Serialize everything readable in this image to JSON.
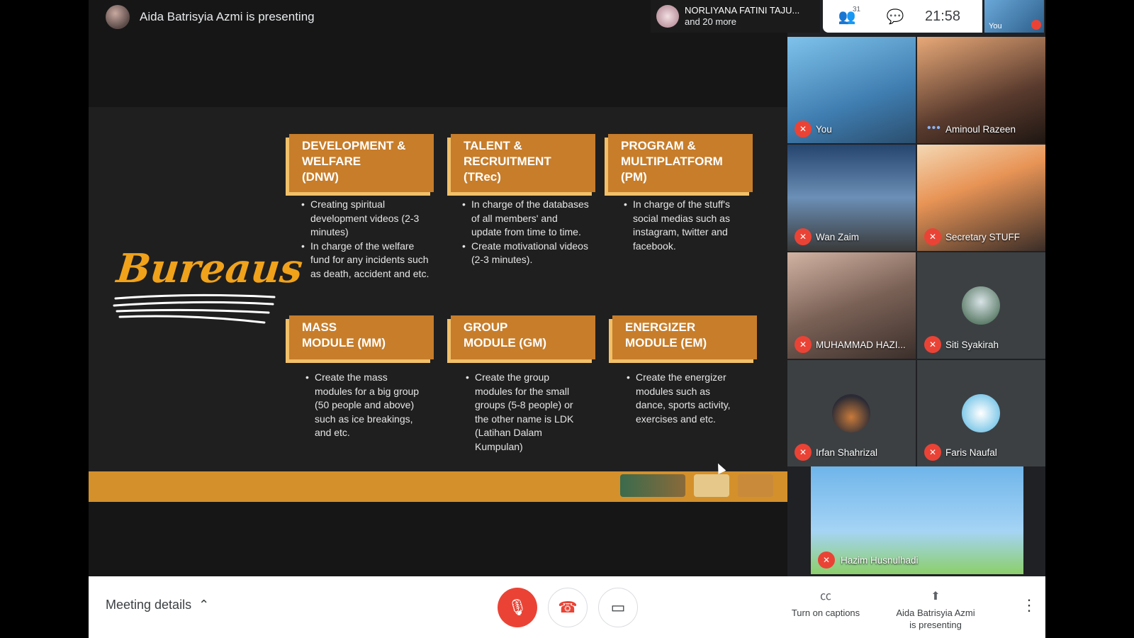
{
  "presenter": {
    "status": "Aida Batrisyia Azmi is presenting"
  },
  "active_speaker": {
    "name": "NORLIYANA FATINI TAJU...",
    "more": "and 20 more"
  },
  "top_controls": {
    "participant_count": "31",
    "time": "21:58",
    "self_label": "You"
  },
  "slide": {
    "heading": "Bureaus",
    "cards": [
      {
        "title": "DEVELOPMENT &\nWELFARE\n(DNW)",
        "bullets": [
          "Creating spiritual development videos (2-3 minutes)",
          "In charge of the welfare fund for any incidents such as death, accident and etc."
        ]
      },
      {
        "title": "TALENT &\nRECRUITMENT\n(TRec)",
        "bullets": [
          "In charge of the databases of all members' and update from time to time.",
          "Create  motivational videos (2-3 minutes)."
        ]
      },
      {
        "title": "PROGRAM &\nMULTIPLATFORM\n(PM)",
        "bullets": [
          "In charge of the stuff's social medias such as instagram, twitter and facebook."
        ]
      },
      {
        "title": "MASS\nMODULE (MM)",
        "bullets": [
          "Create the mass modules for a big group (50 people and above) such as ice breakings, and etc."
        ]
      },
      {
        "title": "GROUP\nMODULE (GM)",
        "bullets": [
          "Create the group modules for the small groups (5-8 people) or the other name is LDK (Latihan Dalam Kumpulan)"
        ]
      },
      {
        "title": "ENERGIZER\nMODULE (EM)",
        "bullets": [
          "Create the energizer modules such as dance, sports activity, exercises and etc."
        ]
      }
    ]
  },
  "participants": [
    {
      "name": "You",
      "muted": true
    },
    {
      "name": "Aminoul Razeen",
      "muted": false
    },
    {
      "name": "Wan Zaim",
      "muted": true
    },
    {
      "name": "Secretary STUFF",
      "muted": true
    },
    {
      "name": "MUHAMMAD HAZI...",
      "muted": true
    },
    {
      "name": "Siti Syakirah",
      "muted": true
    },
    {
      "name": "Irfan Shahrizal",
      "muted": true
    },
    {
      "name": "Faris Naufal",
      "muted": true
    }
  ],
  "self_view": {
    "name": "Hazim Husnulhadi"
  },
  "bottom_bar": {
    "meeting_details": "Meeting details",
    "captions": "Turn on captions",
    "presenting_line1": "Aida Batrisyia Azmi",
    "presenting_line2": "is presenting"
  },
  "colors": {
    "slide_accent": "#c77d2a",
    "slide_shadow": "#f1c069",
    "muted_red": "#ea4335"
  }
}
